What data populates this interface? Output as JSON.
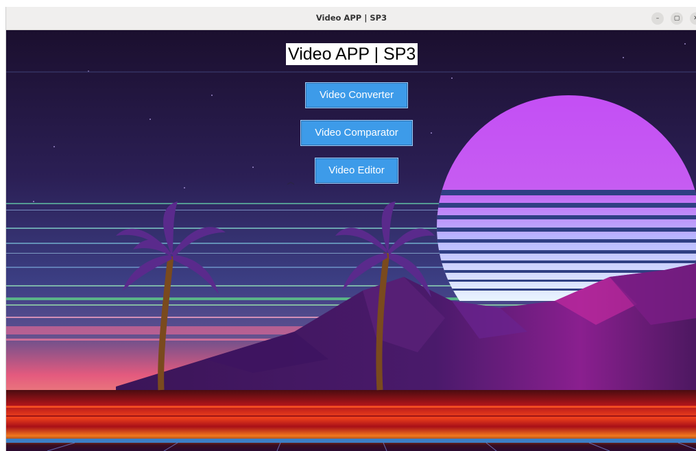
{
  "window": {
    "title": "Video APP | SP3",
    "controls": {
      "minimize": "–",
      "maximize": "▢",
      "close": "✕"
    }
  },
  "app": {
    "heading": "Video APP | SP3",
    "buttons": [
      {
        "label": "Video Converter"
      },
      {
        "label": "Video Comparator"
      },
      {
        "label": "Video Editor"
      }
    ]
  },
  "colors": {
    "button_bg": "#3d9be9",
    "sky_top": "#1c1030",
    "sun_top": "#c147f2",
    "horizon_pink": "#f0637f"
  },
  "icons": [
    "minimize-icon",
    "maximize-icon",
    "close-icon"
  ]
}
